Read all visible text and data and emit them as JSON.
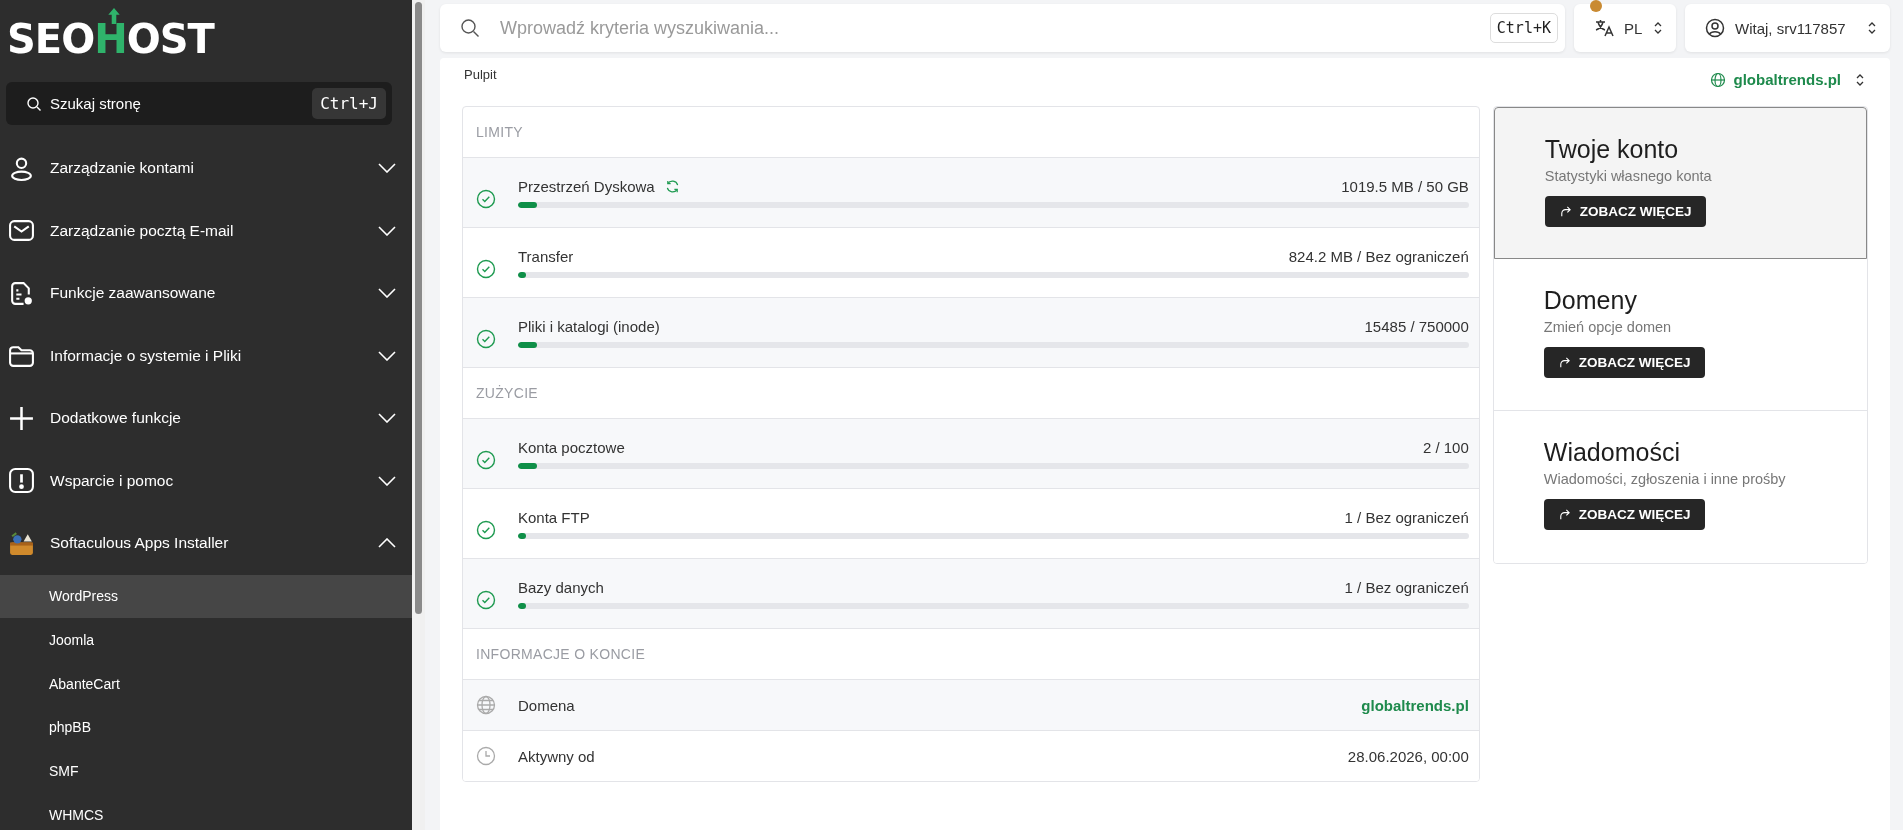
{
  "logo": {
    "before": "SEO",
    "mark": "H",
    "after": "OST"
  },
  "sidebar": {
    "search": {
      "placeholder": "Szukaj stronę",
      "shortcut": "Ctrl+J"
    },
    "items": [
      {
        "label": "Zarządzanie kontami",
        "expanded": false
      },
      {
        "label": "Zarządzanie pocztą E-mail",
        "expanded": false
      },
      {
        "label": "Funkcje zaawansowane",
        "expanded": false
      },
      {
        "label": "Informacje o systemie i Pliki",
        "expanded": false
      },
      {
        "label": "Dodatkowe funkcje",
        "expanded": false
      },
      {
        "label": "Wsparcie i pomoc",
        "expanded": false
      },
      {
        "label": "Softaculous Apps Installer",
        "expanded": true,
        "children": [
          {
            "label": "WordPress",
            "selected": true
          },
          {
            "label": "Joomla",
            "selected": false
          },
          {
            "label": "AbanteCart",
            "selected": false
          },
          {
            "label": "phpBB",
            "selected": false
          },
          {
            "label": "SMF",
            "selected": false
          },
          {
            "label": "WHMCS",
            "selected": false
          }
        ]
      }
    ]
  },
  "topbar": {
    "search": {
      "placeholder": "Wprowadź kryteria wyszukiwania...",
      "shortcut": "Ctrl+K"
    },
    "language": "PL",
    "user": "Witaj, srv117857"
  },
  "breadcrumb": "Pulpit",
  "domain_selector": "globaltrends.pl",
  "sections": [
    {
      "title": "LIMITY",
      "rows": [
        {
          "kind": "meter",
          "label": "Przestrzeń Dyskowa",
          "value": "1019.5 MB / 50 GB",
          "level": 0.02,
          "refreshable": true
        },
        {
          "kind": "meter",
          "label": "Transfer",
          "value": "824.2 MB / Bez ograniczeń",
          "level": 0.008,
          "refreshable": false
        },
        {
          "kind": "meter",
          "label": "Pliki i katalogi (inode)",
          "value": "15485 / 750000",
          "level": 0.02,
          "refreshable": false
        }
      ]
    },
    {
      "title": "ZUŻYCIE",
      "rows": [
        {
          "kind": "meter",
          "label": "Konta pocztowe",
          "value": "2 / 100",
          "level": 0.02,
          "refreshable": false
        },
        {
          "kind": "meter",
          "label": "Konta FTP",
          "value": "1 / Bez ograniczeń",
          "level": 0.008,
          "refreshable": false
        },
        {
          "kind": "meter",
          "label": "Bazy danych",
          "value": "1 / Bez ograniczeń",
          "level": 0.008,
          "refreshable": false
        }
      ]
    },
    {
      "title": "INFORMACJE O KONCIE",
      "rows": [
        {
          "kind": "info",
          "label": "Domena",
          "value": "globaltrends.pl",
          "link": true
        },
        {
          "kind": "info",
          "label": "Aktywny od",
          "value": "28.06.2026, 00:00",
          "link": false
        }
      ]
    }
  ],
  "cards": [
    {
      "title": "Twoje konto",
      "subtitle": "Statystyki własnego konta",
      "button": "ZOBACZ WIĘCEJ",
      "selected": true
    },
    {
      "title": "Domeny",
      "subtitle": "Zmień opcje domen",
      "button": "ZOBACZ WIĘCEJ",
      "selected": false
    },
    {
      "title": "Wiadomości",
      "subtitle": "Wiadomości, zgłoszenia i inne prośby",
      "button": "ZOBACZ WIĘCEJ",
      "selected": false
    }
  ]
}
